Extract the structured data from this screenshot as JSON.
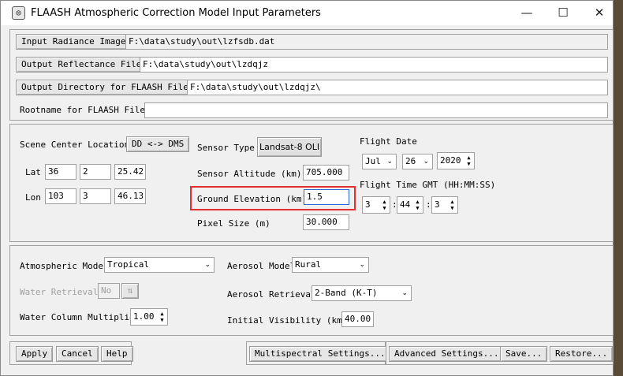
{
  "window": {
    "title": "FLAASH Atmospheric Correction Model Input Parameters",
    "icon_glyph": "◎",
    "minimize_glyph": "—",
    "maximize_glyph": "☐",
    "close_glyph": "✕"
  },
  "files": {
    "input_radiance_label": "Input Radiance Image",
    "input_radiance_value": "F:\\data\\study\\out\\lzfsdb.dat",
    "output_reflectance_label": "Output Reflectance File",
    "output_reflectance_value": "F:\\data\\study\\out\\lzdqjz",
    "output_directory_label": "Output Directory for FLAASH Files",
    "output_directory_value": "F:\\data\\study\\out\\lzdqjz\\",
    "rootname_label": "Rootname for FLAASH Files",
    "rootname_value": ""
  },
  "scene": {
    "center_location_label": "Scene Center Location",
    "dd_dms_button": "DD <-> DMS",
    "lat_label": "Lat",
    "lat_deg": "36",
    "lat_min": "2",
    "lat_sec": "25.42",
    "lon_label": "Lon",
    "lon_deg": "103",
    "lon_min": "3",
    "lon_sec": "46.13"
  },
  "sensor": {
    "type_label": "Sensor Type",
    "type_value": "Landsat-8 OLI",
    "altitude_label": "Sensor Altitude (km)",
    "altitude_value": "705.000",
    "ground_elevation_label": "Ground Elevation (km)",
    "ground_elevation_value": "1.5",
    "pixel_size_label": "Pixel Size (m)",
    "pixel_size_value": "30.000",
    "highlight_color": "#e03030"
  },
  "flight": {
    "date_label": "Flight Date",
    "month": "Jul",
    "day": "26",
    "year": "2020",
    "time_label": "Flight Time GMT (HH:MM:SS)",
    "hour": "3",
    "minute": "44",
    "second": "3",
    "sep": ":"
  },
  "model": {
    "atmospheric_label": "Atmospheric Model",
    "atmospheric_value": "Tropical",
    "water_retrieval_label": "Water Retrieval",
    "water_retrieval_value": "No",
    "water_retrieval_toggle_glyph": "⇅",
    "water_column_label": "Water Column Multiplier",
    "water_column_value": "1.00",
    "aerosol_model_label": "Aerosol Model",
    "aerosol_model_value": "Rural",
    "aerosol_retrieval_label": "Aerosol Retrieval",
    "aerosol_retrieval_value": "2-Band (K-T)",
    "visibility_label": "Initial Visibility (km)",
    "visibility_value": "40.00"
  },
  "buttons": {
    "apply": "Apply",
    "cancel": "Cancel",
    "help": "Help",
    "multispectral": "Multispectral Settings...",
    "advanced": "Advanced Settings...",
    "save": "Save...",
    "restore": "Restore..."
  },
  "glyphs": {
    "chevron": "⌄",
    "up": "▲",
    "down": "▼"
  }
}
